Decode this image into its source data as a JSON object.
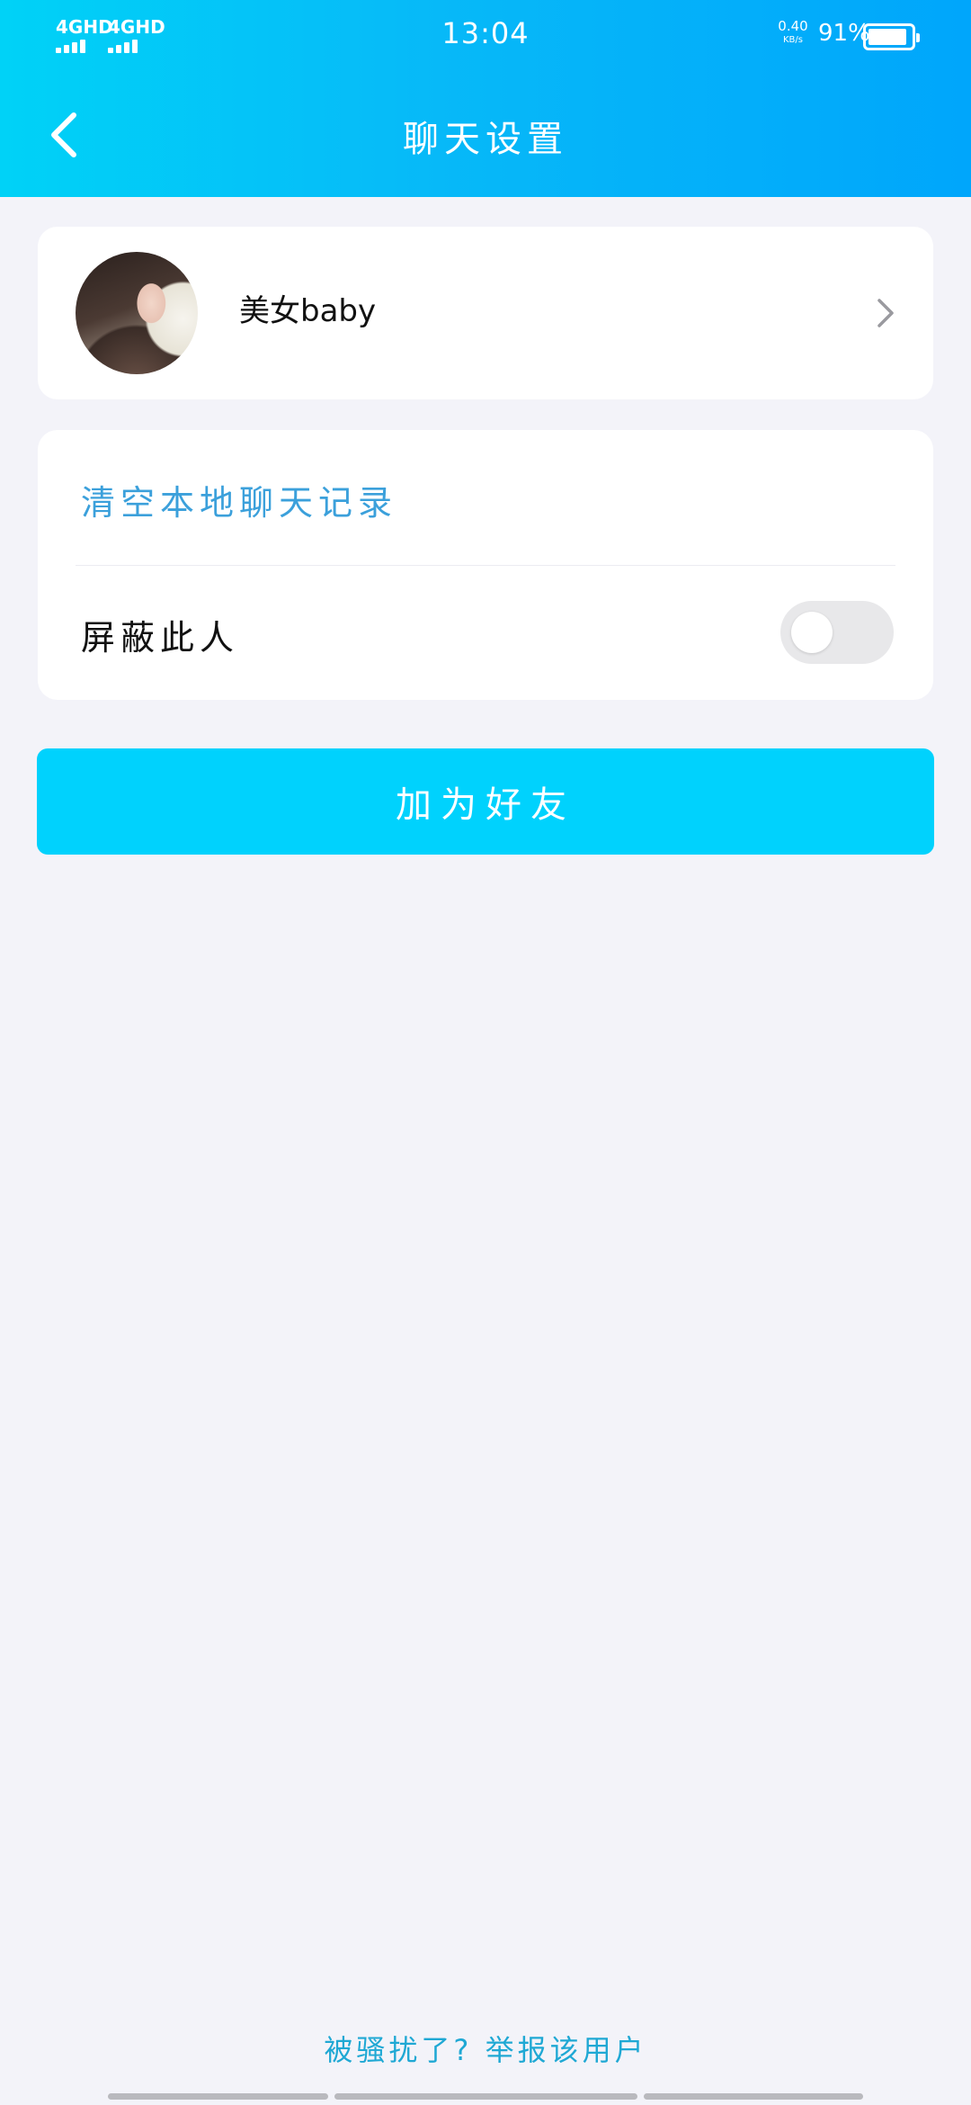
{
  "status_bar": {
    "network_1": "4GHD",
    "network_2": "4GHD",
    "time": "13:04",
    "speed_value": "0.40",
    "speed_unit": "KB/s",
    "battery_percent": "91%",
    "battery_level": 0.91
  },
  "nav": {
    "title": "聊天设置",
    "back_icon": "chevron-left-icon"
  },
  "profile": {
    "name": "美女baby",
    "chevron_icon": "chevron-right-icon"
  },
  "settings": {
    "clear_label": "清空本地聊天记录",
    "block_label": "屏蔽此人",
    "block_enabled": false
  },
  "actions": {
    "add_friend_label": "加为好友",
    "report_text": "被骚扰了? 举报该用户"
  },
  "colors": {
    "header_start": "#00d2f7",
    "header_end": "#00a6fb",
    "button": "#00d2fd",
    "link_blue": "#3ba0db",
    "report_blue": "#1fa8d4",
    "background": "#f3f3f9"
  }
}
